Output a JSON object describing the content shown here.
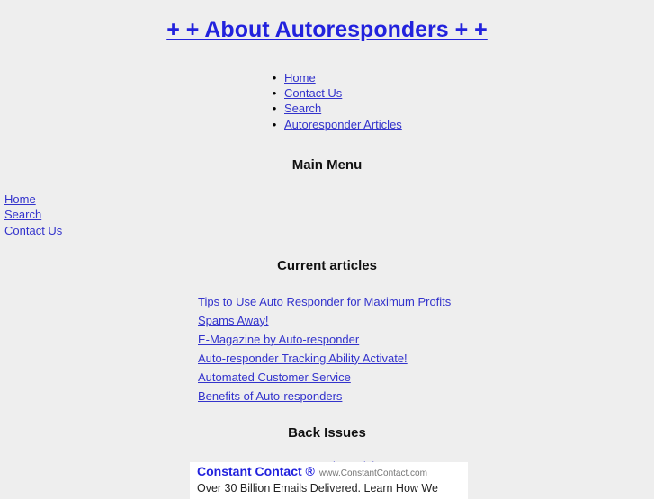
{
  "page": {
    "title": "+ + About Autoresponders + +",
    "background_color": "#eeeeee",
    "link_color": "#3333cc"
  },
  "top_nav": {
    "bullet_glyph": "•",
    "items": [
      {
        "label": "Home"
      },
      {
        "label": "Contact Us"
      },
      {
        "label": "Search"
      },
      {
        "label": "Autoresponder Articles"
      }
    ]
  },
  "main_menu": {
    "heading": "Main Menu",
    "items": [
      {
        "label": "Home"
      },
      {
        "label": "Search"
      },
      {
        "label": "Contact Us"
      }
    ]
  },
  "current_articles": {
    "heading": "Current articles",
    "items": [
      {
        "label": "Tips to Use Auto Responder for Maximum Profits"
      },
      {
        "label": "Spams Away!"
      },
      {
        "label": "E-Magazine by Auto-responder"
      },
      {
        "label": "Auto-responder Tracking Ability Activate!"
      },
      {
        "label": "Automated Customer Service"
      },
      {
        "label": "Benefits of Auto-responders"
      }
    ]
  },
  "back_issues": {
    "heading": "Back Issues",
    "link_label": "Autoresponder Articles"
  },
  "ad": {
    "title": "Constant Contact ®",
    "url": "www.ConstantContact.com",
    "body": "Over 30 Billion Emails Delivered. Learn How We"
  }
}
